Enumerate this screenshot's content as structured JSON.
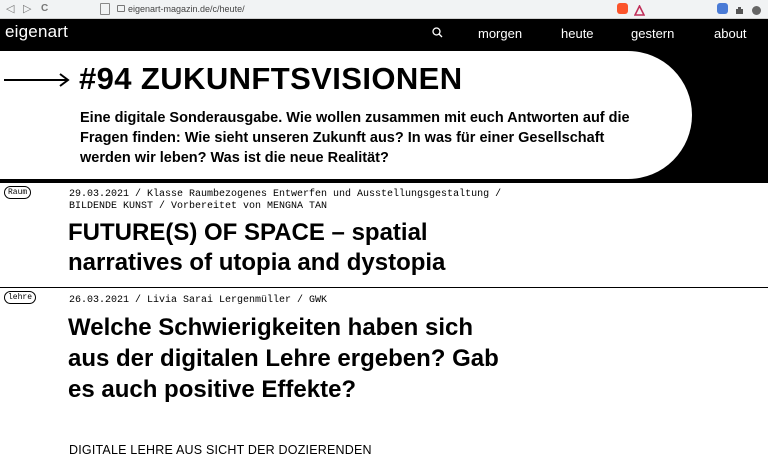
{
  "browser": {
    "url": "eigenart-magazin.de/c/heute/",
    "back": "◁",
    "forward": "▷",
    "reload": "C"
  },
  "site": {
    "logo": "eigenart",
    "nav": [
      "morgen",
      "heute",
      "gestern",
      "about"
    ]
  },
  "hero": {
    "title": "#94 ZUKUNFTSVISIONEN",
    "text": "Eine digitale Sonderausgabe. Wie wollen zusammen mit euch Antworten auf die Fragen finden: Wie sieht unseren Zukunft aus? In was für einer Gesellschaft werden wir leben? Was ist die neue Realität?"
  },
  "articles": [
    {
      "tag": "Raum",
      "meta": "29.03.2021 / Klasse Raumbezogenes Entwerfen und Ausstellungsgestaltung / BILDENDE KUNST / Vorbereitet von MENGNA TAN",
      "title": "FUTURE(S) OF SPACE – spatial narratives of utopia and dystopia"
    },
    {
      "tag": "lehre",
      "meta": "26.03.2021 / Livia Sarai Lergenmüller / GWK",
      "title": "Welche Schwierigkeiten haben sich aus der digitalen Lehre ergeben? Gab es auch positive Effekte?",
      "subtitle": "DIGITALE LEHRE AUS SICHT DER DOZIERENDEN"
    }
  ]
}
